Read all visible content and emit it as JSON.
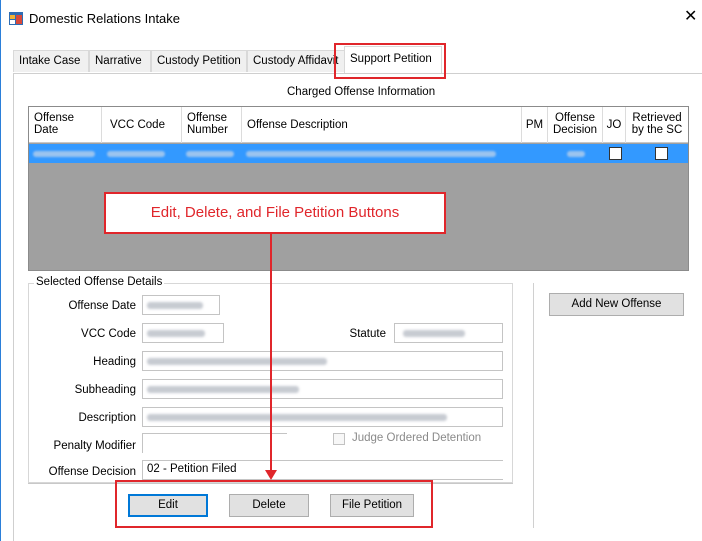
{
  "window": {
    "title": "Domestic Relations Intake",
    "close_glyph": "✕"
  },
  "tabs": [
    "Intake Case",
    "Narrative",
    "Custody Petition",
    "Custody Affidavit",
    "Support Petition"
  ],
  "active_tab": "Support Petition",
  "section_title": "Charged Offense Information",
  "grid": {
    "columns": [
      "Offense Date",
      "VCC Code",
      "Offense Number",
      "Offense Description",
      "PM",
      "Offense Decision",
      "JO",
      "Retrieved by the SC"
    ],
    "selected_row_color": "#3399ff"
  },
  "callout": {
    "text": "Edit, Delete, and File Petition Buttons",
    "color": "#e0262b"
  },
  "details": {
    "legend": "Selected Offense Details",
    "labels": {
      "offense_date": "Offense Date",
      "vcc_code": "VCC Code",
      "statute": "Statute",
      "heading": "Heading",
      "subheading": "Subheading",
      "description": "Description",
      "penalty_modifier": "Penalty Modifier",
      "offense_decision": "Offense Decision"
    },
    "judge_ordered_detention": "Judge Ordered Detention",
    "offense_decision_value": "02 - Petition Filed"
  },
  "buttons": {
    "add_new_offense": "Add New Offense",
    "edit": "Edit",
    "delete": "Delete",
    "file_petition": "File Petition"
  }
}
